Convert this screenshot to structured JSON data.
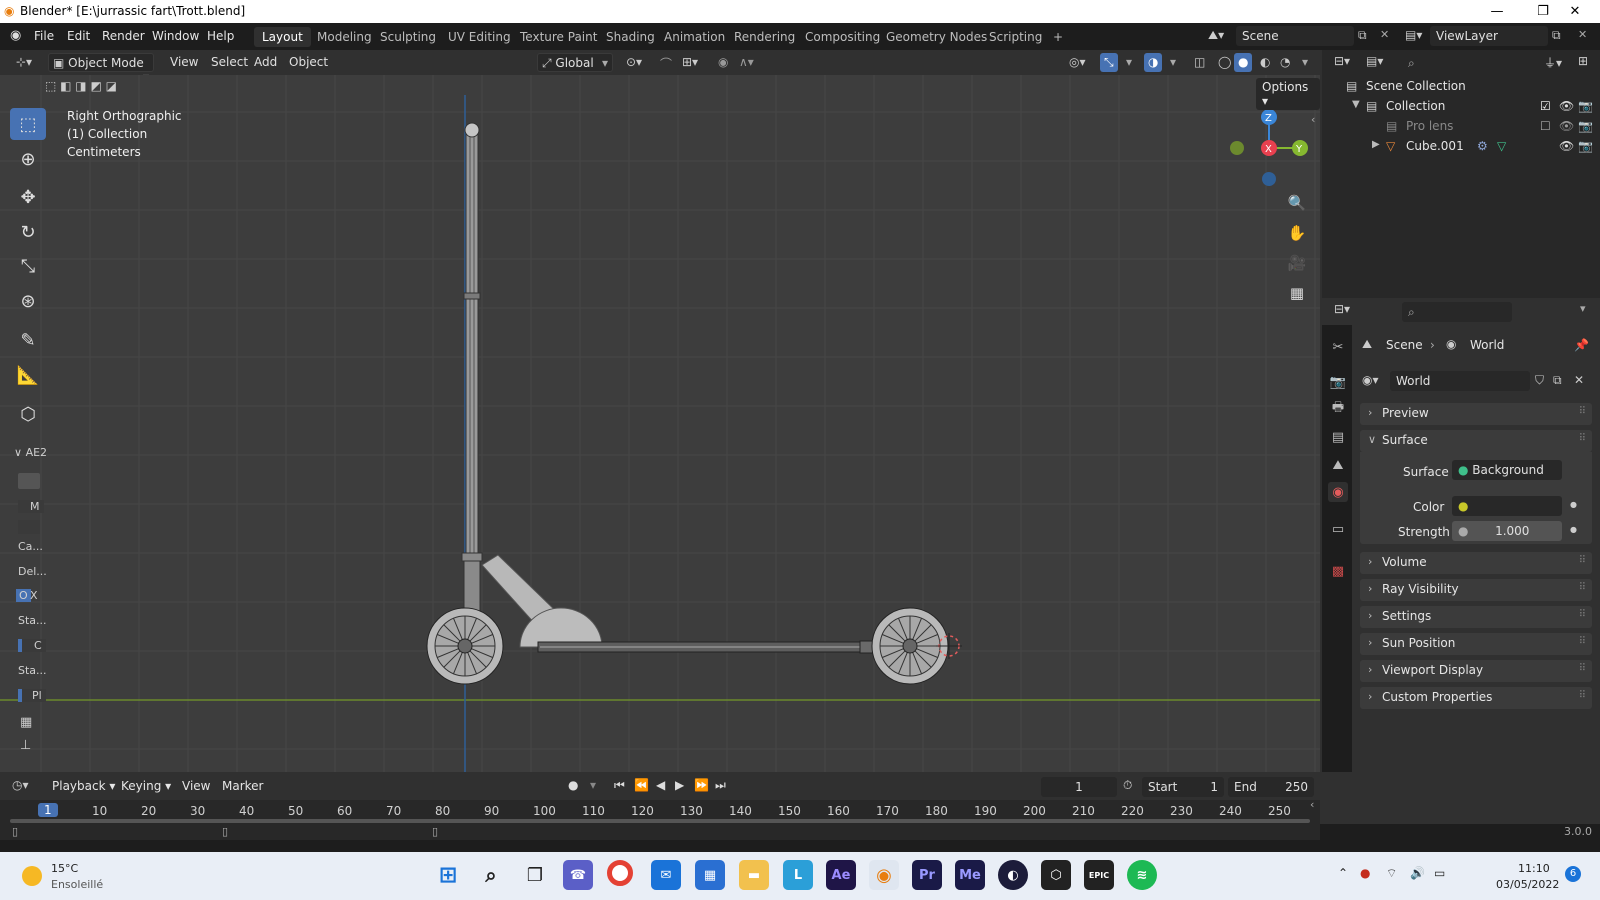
{
  "window": {
    "title": "Blender* [E:\\jurrassic fart\\Trott.blend]"
  },
  "menubar": {
    "items": [
      "File",
      "Edit",
      "Render",
      "Window",
      "Help"
    ]
  },
  "workspaces": {
    "tabs": [
      "Layout",
      "Modeling",
      "Sculpting",
      "UV Editing",
      "Texture Paint",
      "Shading",
      "Animation",
      "Rendering",
      "Compositing",
      "Geometry Nodes",
      "Scripting"
    ],
    "active": "Layout",
    "add": "+"
  },
  "scene": {
    "name": "Scene",
    "view_layer": "ViewLayer"
  },
  "viewport_header": {
    "mode": "Object Mode",
    "menus": [
      "View",
      "Select",
      "Add",
      "Object"
    ],
    "orientation": "Global",
    "options": "Options"
  },
  "viewport": {
    "info": [
      "Right Orthographic",
      "(1) Collection",
      "Centimeters"
    ],
    "gizmo": {
      "z": "Z",
      "x": "X",
      "y": "Y"
    }
  },
  "toolbar_panel": {
    "title": "AE2",
    "items": [
      "M",
      "Ca...",
      "Del...",
      "O",
      "X",
      "Sta...",
      "C",
      "Sta...",
      "Pl"
    ]
  },
  "outliner": {
    "root": "Scene Collection",
    "items": [
      {
        "label": "Collection"
      },
      {
        "label": "Pro lens"
      },
      {
        "label": "Cube.001"
      }
    ]
  },
  "properties": {
    "breadcrumb": [
      "Scene",
      "World"
    ],
    "datablock": "World",
    "panels": [
      "Preview",
      "Surface",
      "Volume",
      "Ray Visibility",
      "Settings",
      "Sun Position",
      "Viewport Display",
      "Custom Properties"
    ],
    "surface": {
      "label": "Surface",
      "value": "Background"
    },
    "color": {
      "label": "Color"
    },
    "strength": {
      "label": "Strength",
      "value": "1.000"
    }
  },
  "timeline": {
    "menus": [
      "Playback",
      "Keying",
      "View",
      "Marker"
    ],
    "current_frame": "1",
    "start_label": "Start",
    "start": "1",
    "end_label": "End",
    "end": "250",
    "ticks": [
      "10",
      "20",
      "30",
      "40",
      "50",
      "60",
      "70",
      "80",
      "90",
      "100",
      "110",
      "120",
      "130",
      "140",
      "150",
      "160",
      "170",
      "180",
      "190",
      "200",
      "210",
      "220",
      "230",
      "240",
      "250"
    ]
  },
  "status": {
    "version": "3.0.0"
  },
  "taskbar": {
    "weather_temp": "15°C",
    "weather_desc": "Ensoleillé",
    "time": "11:10",
    "date": "03/05/2022",
    "notif": "6",
    "apps": [
      "Ae",
      "Pr",
      "Me"
    ]
  },
  "colors": {
    "accent": "#4772b3",
    "x_axis": "#e8404f",
    "y_axis": "#86b830",
    "z_axis": "#3a86d8"
  }
}
